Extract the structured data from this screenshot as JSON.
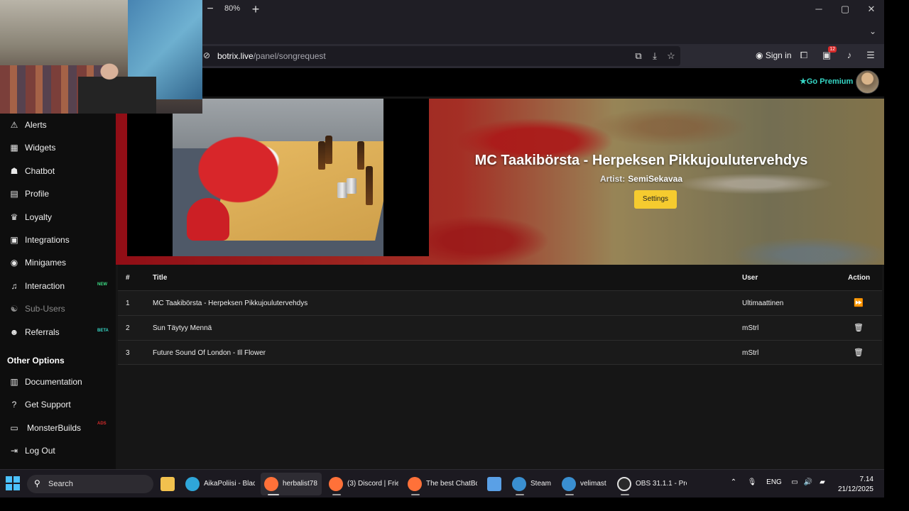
{
  "browser": {
    "zoom_minus": "−",
    "zoom_level": "80%",
    "zoom_plus": "+",
    "window_buttons": [
      "─",
      "▢",
      "✕"
    ],
    "url_host": "botrix.live",
    "url_path": "/panel/songrequest",
    "sign_in": "Sign in",
    "extension_badge": "12"
  },
  "site": {
    "go_premium": "Go Premium"
  },
  "sidebar": {
    "items": [
      {
        "label": "Alerts",
        "icon": "warning-icon",
        "glyph": "⚠"
      },
      {
        "label": "Widgets",
        "icon": "grid-icon",
        "glyph": "▦"
      },
      {
        "label": "Chatbot",
        "icon": "robot-icon",
        "glyph": "☗"
      },
      {
        "label": "Profile",
        "icon": "id-card-icon",
        "glyph": "▤"
      },
      {
        "label": "Loyalty",
        "icon": "trophy-icon",
        "glyph": "♛"
      },
      {
        "label": "Integrations",
        "icon": "integrations-icon",
        "glyph": "▣"
      },
      {
        "label": "Minigames",
        "icon": "gamepad-icon",
        "glyph": "◉"
      },
      {
        "label": "Interaction",
        "icon": "music-icon",
        "glyph": "♫",
        "badge": "NEW",
        "badge_color": "#3ddc84"
      },
      {
        "label": "Sub-Users",
        "icon": "sub-users-icon",
        "glyph": "☯",
        "disabled": true
      },
      {
        "label": "Referrals",
        "icon": "users-icon",
        "glyph": "☻",
        "badge": "BETA",
        "badge_color": "#36d6c5"
      }
    ],
    "other_heading": "Other Options",
    "other_items": [
      {
        "label": "Documentation",
        "icon": "book-icon",
        "glyph": "▥"
      },
      {
        "label": "Get Support",
        "icon": "question-icon",
        "glyph": "?"
      },
      {
        "label": "MonsterBuilds",
        "icon": "laptop-icon",
        "glyph": "▭",
        "badge": "ADS",
        "badge_color": "#d62b2b"
      },
      {
        "label": "Log Out",
        "icon": "logout-icon",
        "glyph": "⇥"
      }
    ]
  },
  "now_playing": {
    "title": "MC Taakibörsta - Herpeksen Pikkujoulutervehdys",
    "artist_label": "Artist:",
    "artist": "SemiSekavaa",
    "settings_label": "Settings"
  },
  "queue": {
    "headers": {
      "num": "#",
      "title": "Title",
      "user": "User",
      "action": "Action"
    },
    "rows": [
      {
        "num": "1",
        "title": "MC Taakibörsta - Herpeksen Pikkujoulutervehdys",
        "user": "Ultimaattinen",
        "action_icon": "skip-icon",
        "glyph": "⏩"
      },
      {
        "num": "2",
        "title": "Sun Täytyy Mennä",
        "user": "mStrl",
        "action_icon": "trash-icon",
        "glyph": "🗑"
      },
      {
        "num": "3",
        "title": "Future Sound Of London - Ill Flower",
        "user": "mStrl",
        "action_icon": "trash-icon",
        "glyph": "🗑"
      }
    ]
  },
  "taskbar": {
    "search": "Search",
    "apps": [
      {
        "label": "",
        "icon": "file-explorer-icon",
        "color": "#f2c14e"
      },
      {
        "label": "AikaPoliisi - Blac",
        "icon": "edge-icon",
        "color": "#2fa6d9"
      },
      {
        "label": "herbalist78",
        "icon": "firefox-icon",
        "color": "#ff7139",
        "active": true
      },
      {
        "label": "(3) Discord | Frie",
        "icon": "firefox-icon",
        "color": "#ff7139"
      },
      {
        "label": "The best ChatBc",
        "icon": "firefox-icon",
        "color": "#ff7139"
      },
      {
        "label": "",
        "icon": "store-icon",
        "color": "#5aa0e6"
      },
      {
        "label": "Steam",
        "icon": "steam-icon",
        "color": "#3a8fd0"
      },
      {
        "label": "velimast",
        "icon": "steam-icon",
        "color": "#3a8fd0"
      },
      {
        "label": "OBS 31.1.1 - Prof",
        "icon": "obs-icon",
        "color": "#e0e0e0"
      }
    ],
    "tray": {
      "lang": "ENG"
    },
    "time": "7.14",
    "date": "21/12/2025"
  }
}
